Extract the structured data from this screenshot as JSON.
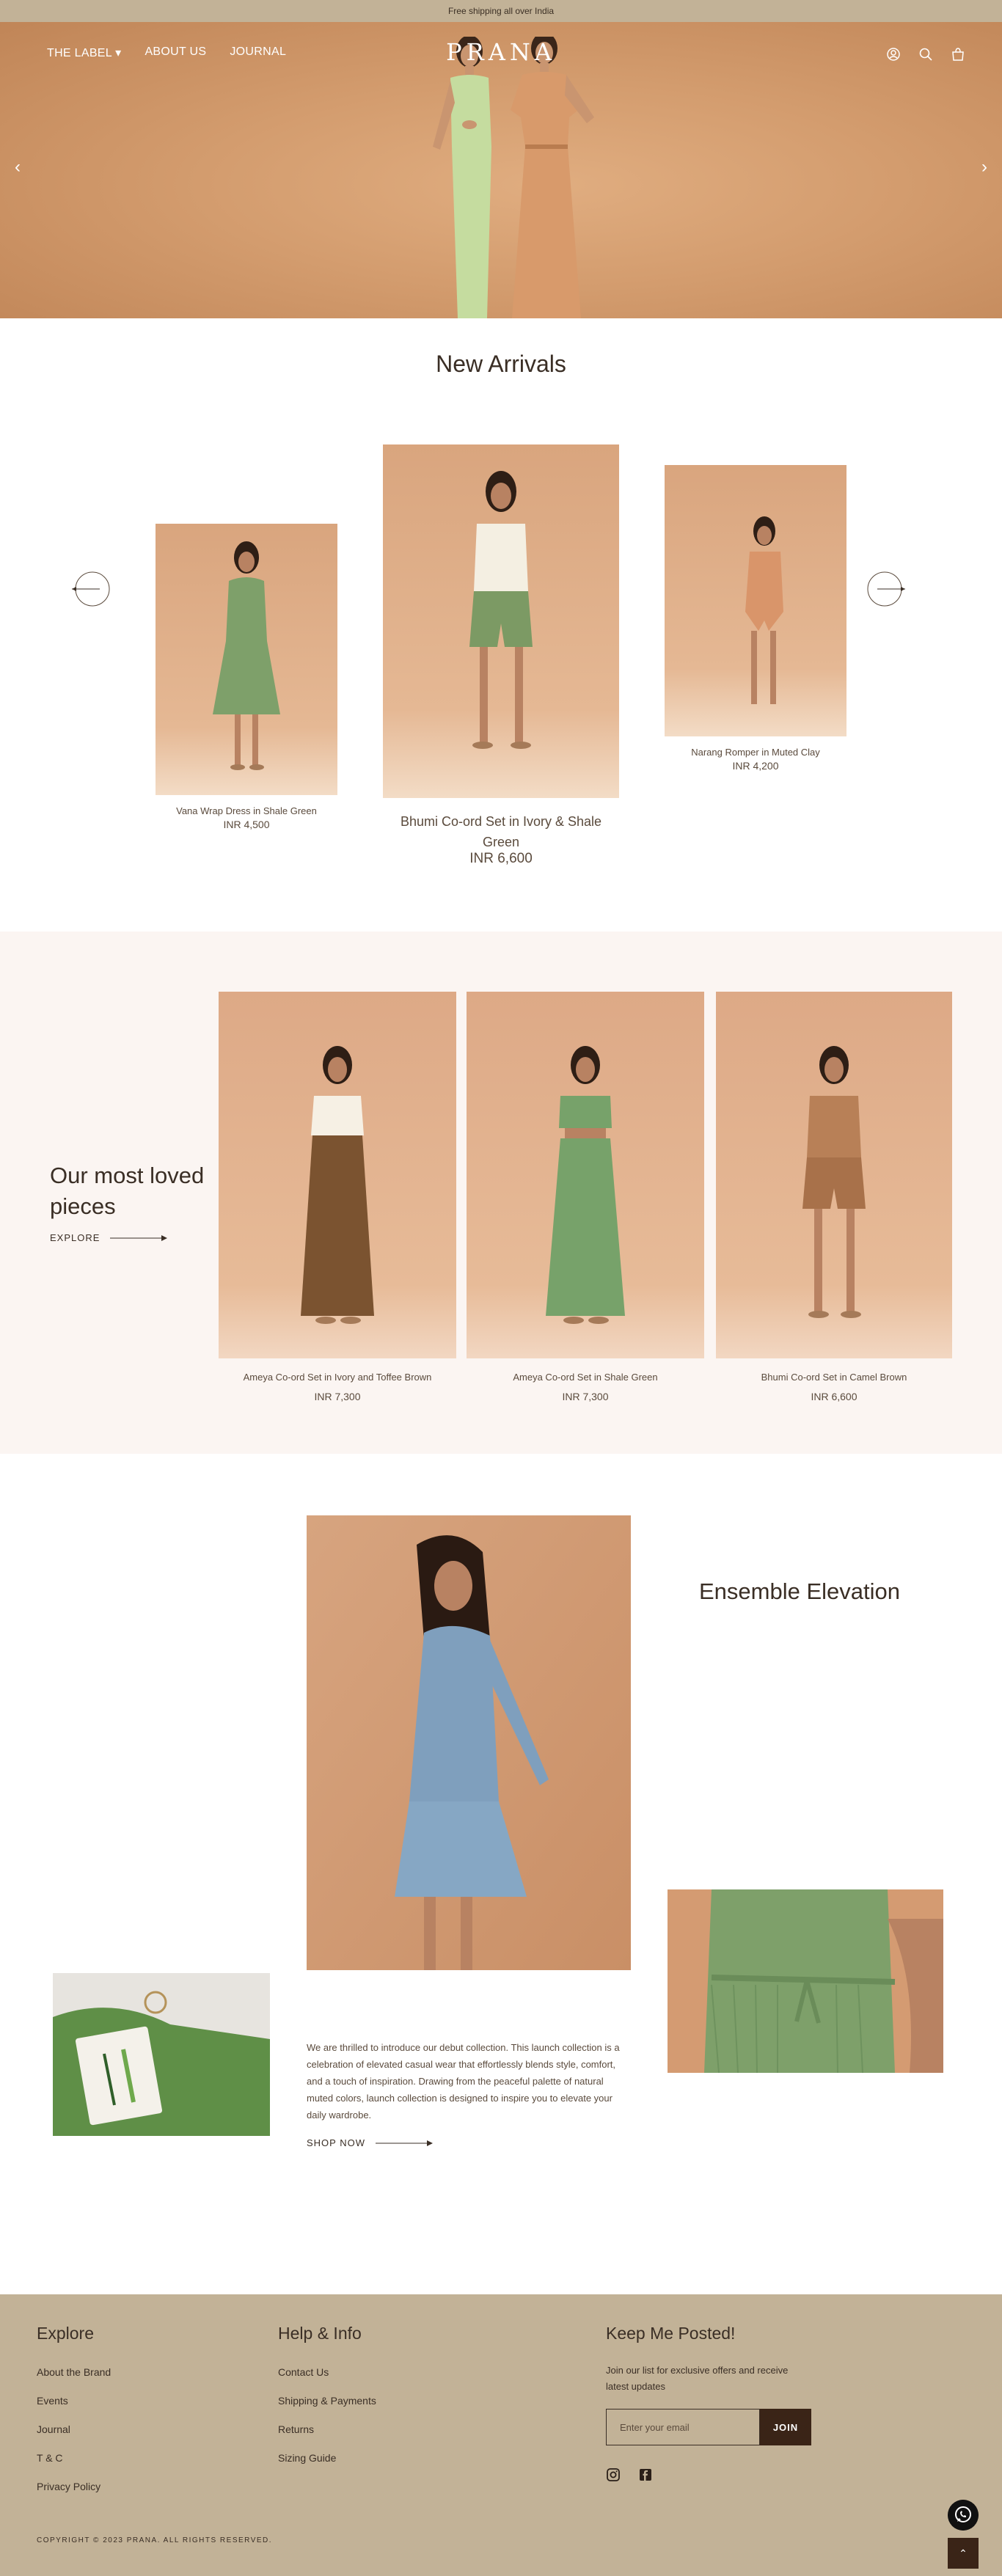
{
  "announcement": "Free shipping all over India",
  "header": {
    "logo": "PRANA",
    "nav": [
      {
        "label": "THE LABEL ▾"
      },
      {
        "label": "ABOUT US"
      },
      {
        "label": "JOURNAL"
      }
    ],
    "icons": [
      "account-icon",
      "search-icon",
      "cart-icon"
    ]
  },
  "hero": {
    "prev_icon": "‹",
    "next_icon": "›"
  },
  "new_arrivals": {
    "title": "New Arrivals",
    "products": [
      {
        "name": "Vana Wrap Dress in Shale Green",
        "price": "INR 4,500",
        "dress_color": "#7ea06a"
      },
      {
        "name": "Bhumi Co-ord Set in Ivory & Shale Green",
        "price": "INR 6,600",
        "dress_color": "#f4efe2"
      },
      {
        "name": "Narang Romper in Muted Clay",
        "price": "INR 4,200",
        "dress_color": "#d9956a"
      }
    ]
  },
  "loved": {
    "title": "Our most loved pieces",
    "explore": "EXPLORE",
    "products": [
      {
        "name": "Ameya Co-ord Set in Ivory and Toffee Brown",
        "price": "INR 7,300",
        "dress_color": "#7b5330"
      },
      {
        "name": "Ameya Co-ord Set in Shale Green",
        "price": "INR 7,300",
        "dress_color": "#77a26a"
      },
      {
        "name": "Bhumi Co-ord Set in Camel Brown",
        "price": "INR 6,600",
        "dress_color": "#b88057"
      }
    ]
  },
  "ensemble": {
    "title": "Ensemble Elevation",
    "text": "We are thrilled to introduce our debut collection. This launch collection is a celebration of elevated casual wear that effortlessly blends style, comfort, and a touch of inspiration. Drawing from the peaceful palette of natural muted colors, launch collection is designed to inspire you to elevate your daily wardrobe.",
    "cta": "SHOP NOW"
  },
  "footer": {
    "explore_title": "Explore",
    "explore_links": [
      {
        "label": "About the Brand"
      },
      {
        "label": "Events"
      },
      {
        "label": "Journal"
      },
      {
        "label": "T & C"
      },
      {
        "label": "Privacy Policy"
      }
    ],
    "help_title": "Help & Info",
    "help_links": [
      {
        "label": "Contact Us"
      },
      {
        "label": "Shipping & Payments"
      },
      {
        "label": "Returns"
      },
      {
        "label": "Sizing Guide"
      }
    ],
    "newsletter_title": "Keep Me Posted!",
    "newsletter_desc": "Join our list for exclusive offers and receive latest updates",
    "email_placeholder": "Enter your email",
    "join_label": "JOIN",
    "copyright": "COPYRIGHT © 2023 PRANA. ALL RIGHTS RESERVED.",
    "to_top_icon": "⌃"
  },
  "colors": {
    "bar": "#c2b297",
    "footer": "#c2b297",
    "accent_dark": "#3a2417",
    "section_bg": "#fbf5f2"
  }
}
